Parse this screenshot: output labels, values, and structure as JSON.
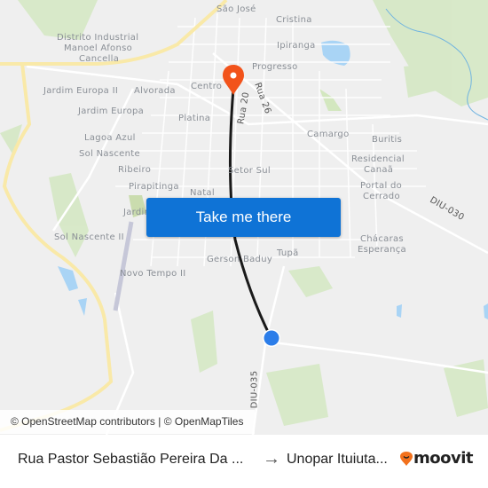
{
  "map": {
    "labels": {
      "sao_jose": "São José",
      "cristina": "Cristina",
      "distrito": "Distrito Industrial",
      "manoel": "Manoel Afonso",
      "cancella": "Cancella",
      "ipiranga": "Ipiranga",
      "progresso": "Progresso",
      "centro": "Centro",
      "rua20": "Rua 20",
      "rua26": "Rua 26",
      "jardim_europa_ii": "Jardim Europa II",
      "alvorada": "Alvorada",
      "jardim_europa": "Jardim Europa",
      "platina": "Platina",
      "camargo": "Camargo",
      "buritis": "Buritis",
      "lagoa_azul": "Lagoa Azul",
      "residencial": "Residencial",
      "canaa": "Canaã",
      "sol_nascente": "Sol Nascente",
      "setor_sul": "Setor Sul",
      "ribeiro": "Ribeiro",
      "portal_do": "Portal do",
      "cerrado": "Cerrado",
      "pirapitinga": "Pirapitinga",
      "natal": "Natal",
      "diu030": "DIU-030",
      "jardim": "Jardim",
      "sol_nascente_ii": "Sol Nascente II",
      "chacaras": "Chácaras",
      "esperanca": "Esperança",
      "gerson_baduy": "Gerson Baduy",
      "tupa": "Tupã",
      "novo_tempo_ii": "Novo Tempo II",
      "diu035": "DIU-035"
    },
    "cta_label": "Take me there",
    "attribution": "© OpenStreetMap contributors | © OpenMapTiles",
    "colors": {
      "destination_pin": "#f2531b",
      "origin_dot": "#2b7de9",
      "route_line": "#1a1a1a",
      "cta_background": "#0f73d6",
      "highway": "#f9e9a8",
      "water": "#a9d4f5",
      "park": "#d5e8c4"
    }
  },
  "footer": {
    "origin": "Rua Pastor Sebastião Pereira Da ...",
    "arrow": "→",
    "destination": "Unopar Ituiuta...",
    "brand": "moovit"
  }
}
